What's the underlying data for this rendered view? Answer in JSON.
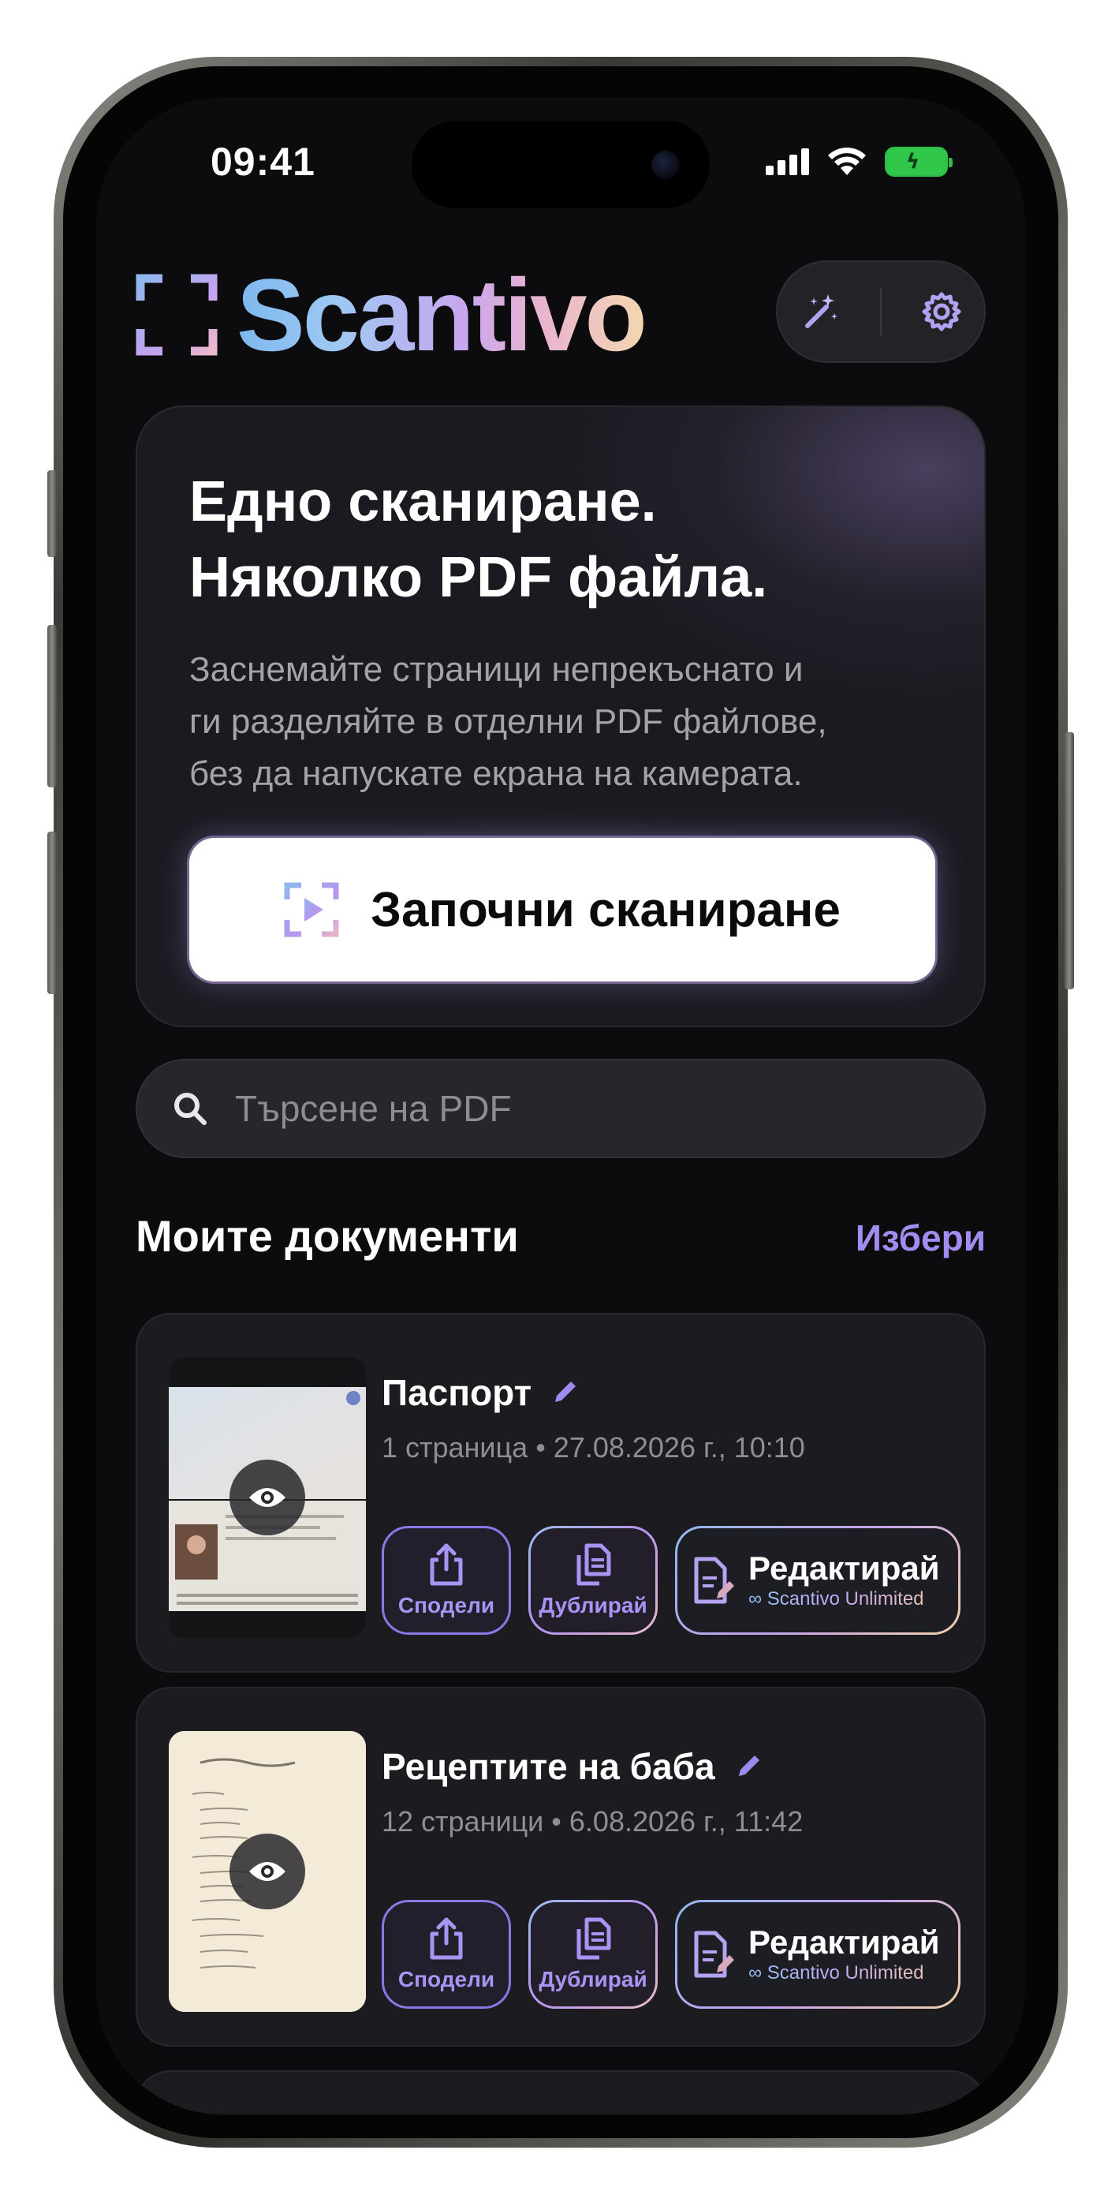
{
  "status": {
    "time": "09:41"
  },
  "app": {
    "logo_text": "Scantivo"
  },
  "hero": {
    "title_line1": "Едно сканиране.",
    "title_line2": "Няколко PDF файла.",
    "subtitle_line1": "Заснемайте страници непрекъснато и",
    "subtitle_line2": "ги разделяйте в отделни PDF файлове,",
    "subtitle_line3": "без да напускате екрана на камерата.",
    "cta_label": "Започни сканиране"
  },
  "search": {
    "placeholder": "Търсене на PDF"
  },
  "documents_section": {
    "title": "Моите документи",
    "select_label": "Избери"
  },
  "documents": [
    {
      "name": "Паспорт",
      "meta": "1 страница • 27.08.2026 г., 10:10",
      "share_label": "Сподели",
      "duplicate_label": "Дублирай",
      "edit_label": "Редактирай",
      "edit_sub": "∞ Scantivo Unlimited"
    },
    {
      "name": "Рецептите на баба",
      "meta": "12 страници • 6.08.2026 г., 11:42",
      "share_label": "Сподели",
      "duplicate_label": "Дублирай",
      "edit_label": "Редактирай",
      "edit_sub": "∞ Scantivo Unlimited"
    }
  ],
  "icons": {
    "magic": "magic-wand-icon",
    "settings": "gear-icon",
    "search": "search-icon",
    "share": "share-icon",
    "duplicate": "duplicate-icon",
    "edit": "document-edit-icon",
    "preview": "eye-icon",
    "rename": "pencil-icon"
  },
  "colors": {
    "accent": "#a38cf0",
    "background": "#0c0c0e",
    "card": "#1c1c20"
  }
}
